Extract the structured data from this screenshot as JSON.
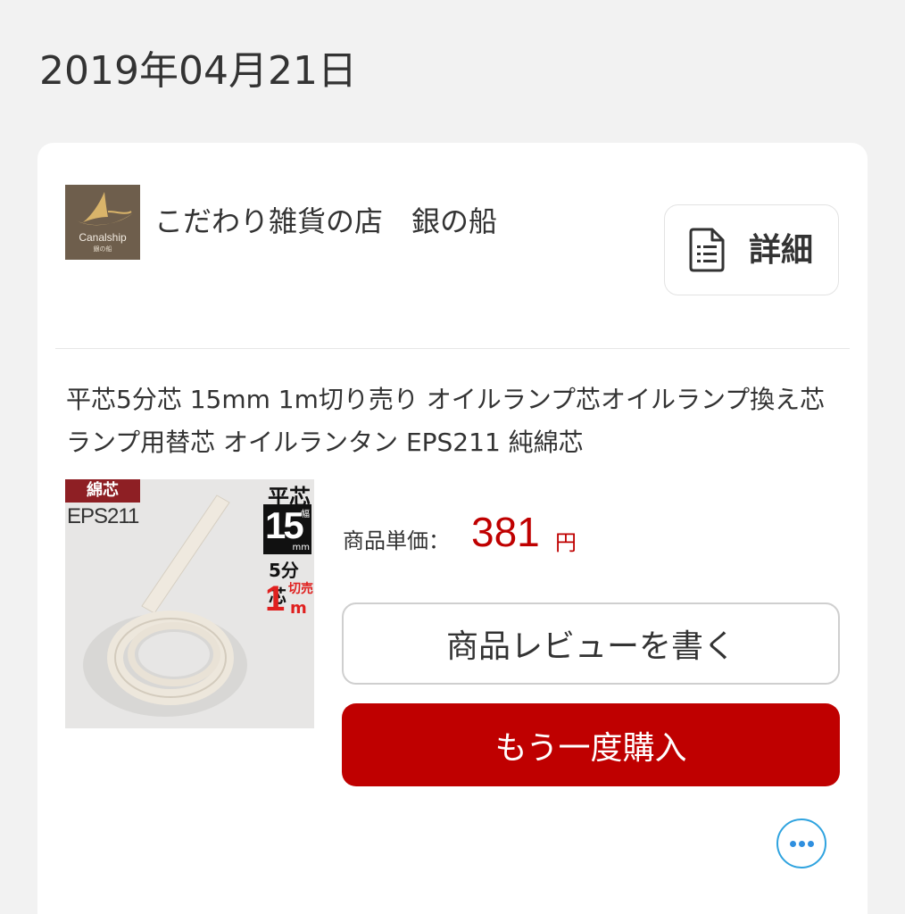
{
  "order": {
    "date": "2019年04月21日"
  },
  "shop": {
    "logo_text": "Canalship",
    "logo_subtext": "銀の船",
    "name": "こだわり雑貨の店　銀の船",
    "details_label": "詳細",
    "details_icon": "document-icon"
  },
  "product": {
    "title": " 平芯5分芯 15mm 1m切り売り オイルランプ芯オイルランプ換え芯ランプ用替芯 オイルランタン EPS211 純綿芯",
    "image_labels": {
      "material": "綿芯",
      "code": "EPS211",
      "type": "平芯",
      "width": "15",
      "width_label": "幅",
      "width_unit": "mm",
      "size": "5分芯",
      "length": "1",
      "cut": "切売",
      "length_unit": "m"
    },
    "price_label": "商品単価：",
    "price_value": "381",
    "price_unit": "円"
  },
  "actions": {
    "review_label": "商品レビューを書く",
    "rebuy_label": "もう一度購入",
    "more_icon": "more-horizontal-icon"
  },
  "colors": {
    "accent_red": "#bf0000",
    "more_blue": "#2fa3df",
    "background": "#f2f2f2"
  }
}
